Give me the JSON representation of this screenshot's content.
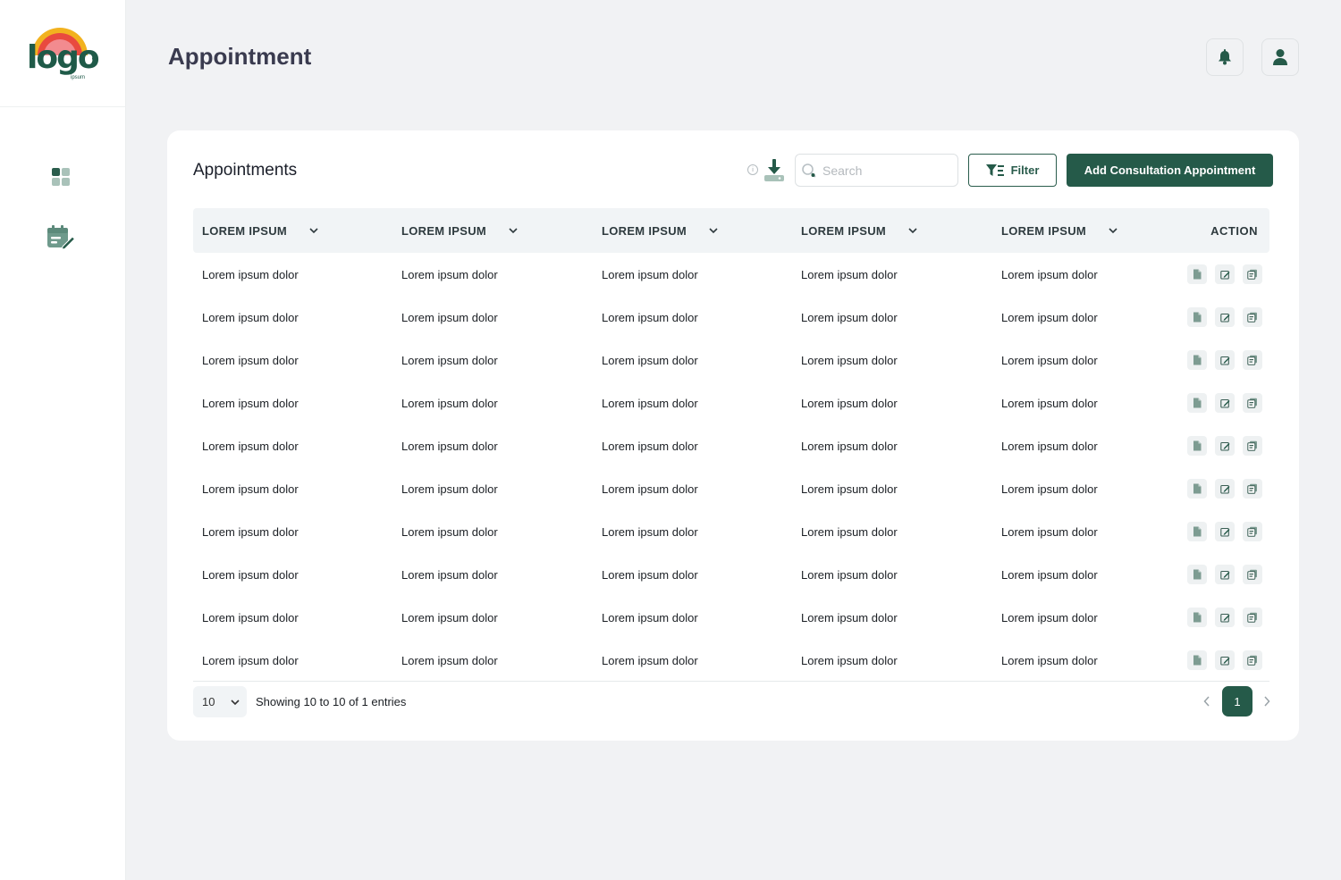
{
  "app": {
    "logo_text": "logo",
    "logo_sub": "ipsum",
    "page_title": "Appointment"
  },
  "sidebar": {
    "items": [
      {
        "name": "dashboard",
        "icon": "grid-icon",
        "active": false
      },
      {
        "name": "appointments",
        "icon": "calendar-edit-icon",
        "active": true
      }
    ]
  },
  "header": {
    "notification_icon": "bell-icon",
    "profile_icon": "user-icon"
  },
  "card": {
    "title": "Appointments",
    "search_placeholder": "Search",
    "filter_label": "Filter",
    "add_label": "Add Consultation Appointment"
  },
  "table": {
    "columns": [
      "LOREM IPSUM",
      "LOREM IPSUM",
      "LOREM IPSUM",
      "LOREM IPSUM",
      "LOREM IPSUM"
    ],
    "action_header": "ACTION",
    "rows": [
      [
        "Lorem ipsum dolor",
        "Lorem ipsum dolor",
        "Lorem ipsum dolor",
        "Lorem ipsum dolor",
        "Lorem ipsum dolor"
      ],
      [
        "Lorem ipsum dolor",
        "Lorem ipsum dolor",
        "Lorem ipsum dolor",
        "Lorem ipsum dolor",
        "Lorem ipsum dolor"
      ],
      [
        "Lorem ipsum dolor",
        "Lorem ipsum dolor",
        "Lorem ipsum dolor",
        "Lorem ipsum dolor",
        "Lorem ipsum dolor"
      ],
      [
        "Lorem ipsum dolor",
        "Lorem ipsum dolor",
        "Lorem ipsum dolor",
        "Lorem ipsum dolor",
        "Lorem ipsum dolor"
      ],
      [
        "Lorem ipsum dolor",
        "Lorem ipsum dolor",
        "Lorem ipsum dolor",
        "Lorem ipsum dolor",
        "Lorem ipsum dolor"
      ],
      [
        "Lorem ipsum dolor",
        "Lorem ipsum dolor",
        "Lorem ipsum dolor",
        "Lorem ipsum dolor",
        "Lorem ipsum dolor"
      ],
      [
        "Lorem ipsum dolor",
        "Lorem ipsum dolor",
        "Lorem ipsum dolor",
        "Lorem ipsum dolor",
        "Lorem ipsum dolor"
      ],
      [
        "Lorem ipsum dolor",
        "Lorem ipsum dolor",
        "Lorem ipsum dolor",
        "Lorem ipsum dolor",
        "Lorem ipsum dolor"
      ],
      [
        "Lorem ipsum dolor",
        "Lorem ipsum dolor",
        "Lorem ipsum dolor",
        "Lorem ipsum dolor",
        "Lorem ipsum dolor"
      ],
      [
        "Lorem ipsum dolor",
        "Lorem ipsum dolor",
        "Lorem ipsum dolor",
        "Lorem ipsum dolor",
        "Lorem ipsum dolor"
      ]
    ],
    "row_actions": [
      "view-document-icon",
      "edit-icon",
      "copy-icon"
    ]
  },
  "pagination": {
    "page_size": "10",
    "entries_text": "Showing 10 to 10 of 1 entries",
    "current_page": "1"
  },
  "colors": {
    "brand": "#255a49",
    "background": "#f1f2f4"
  }
}
